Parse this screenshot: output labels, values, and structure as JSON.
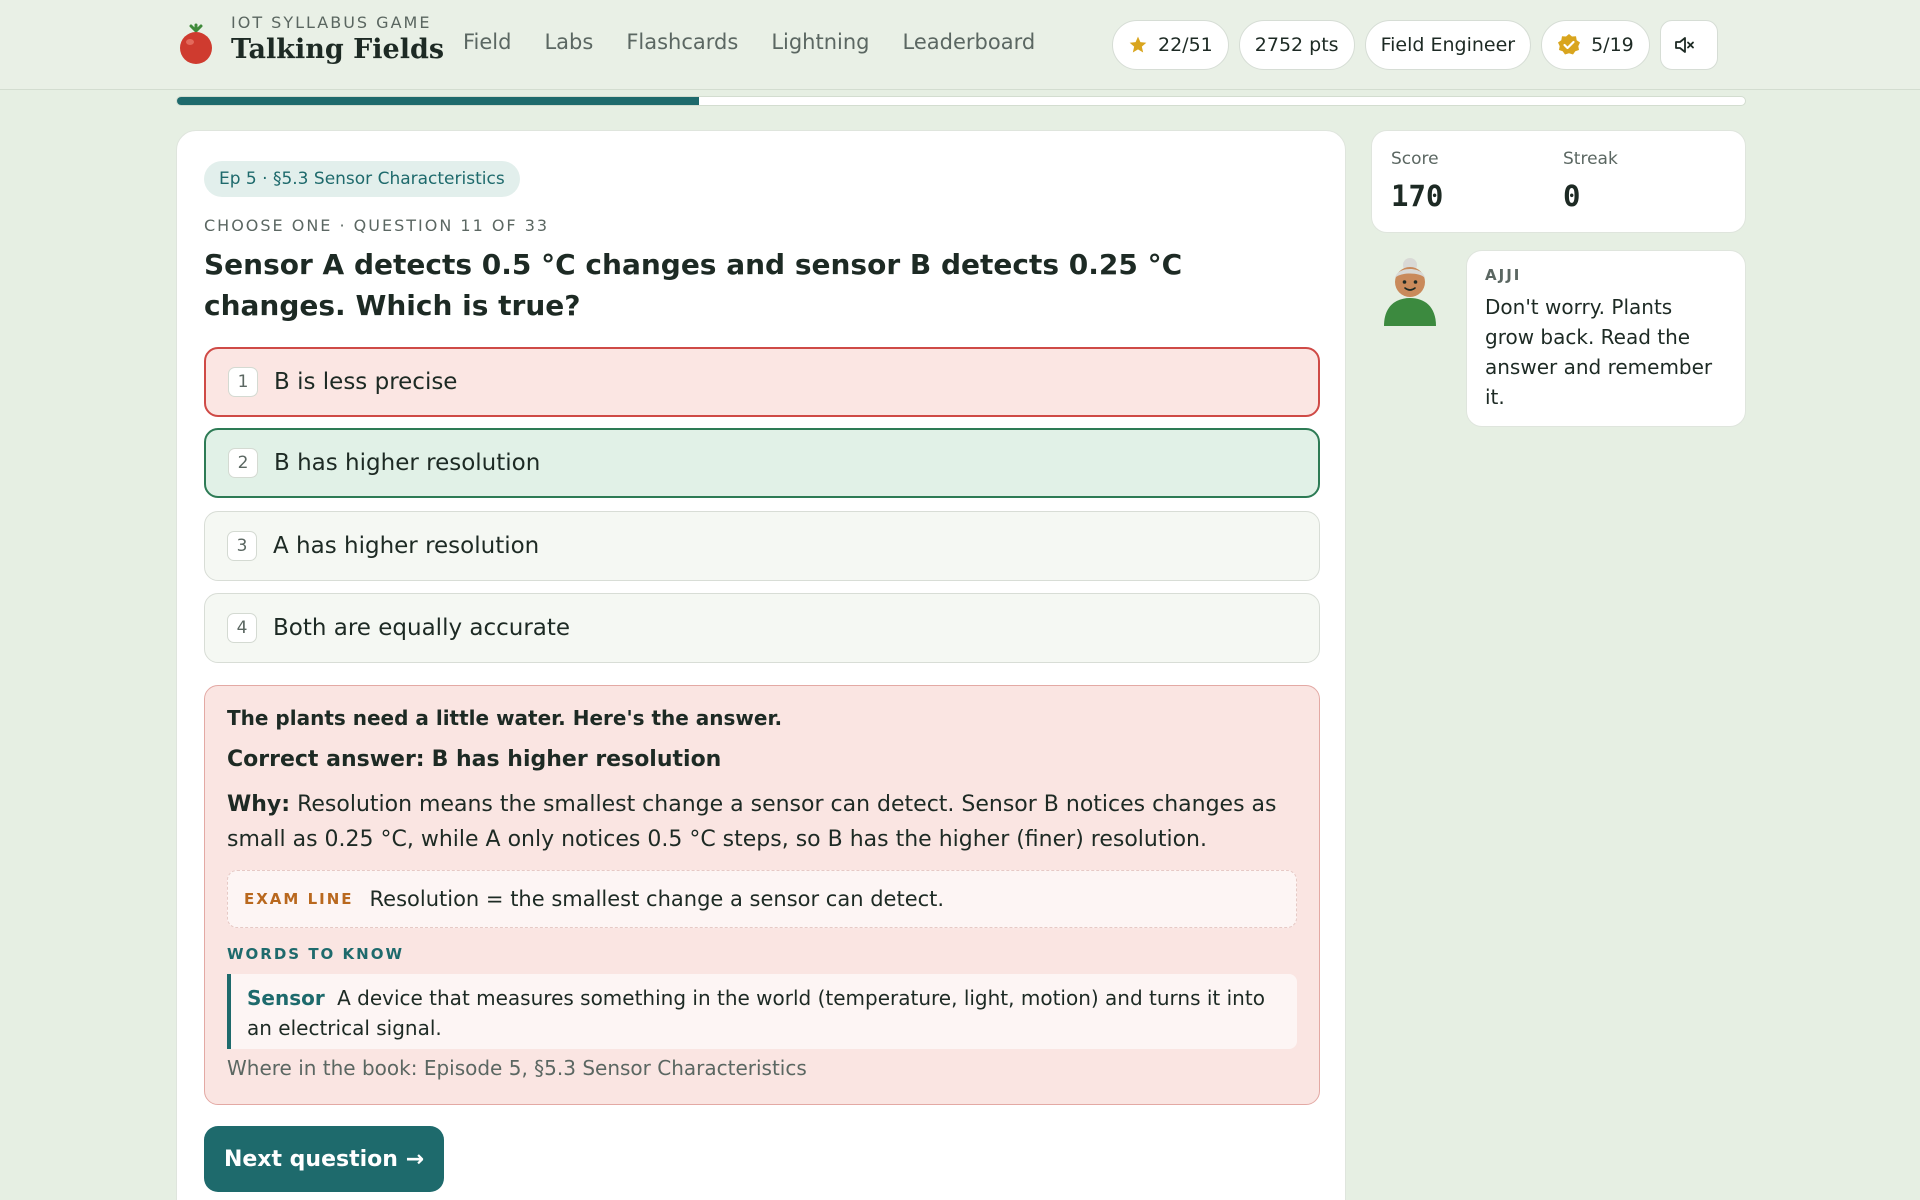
{
  "header": {
    "brand_sub": "IOT SYLLABUS GAME",
    "brand_title": "Talking Fields",
    "nav": [
      "Field",
      "Labs",
      "Flashcards",
      "Lightning",
      "Leaderboard"
    ],
    "stars": "22/51",
    "points": "2752 pts",
    "rank": "Field Engineer",
    "badges": "5/19",
    "sound_icon": "mute-icon"
  },
  "progress": {
    "fraction": 0.333
  },
  "quiz": {
    "chapter_badge": "Ep 5 · §5.3 Sensor Characteristics",
    "meta": "CHOOSE ONE · QUESTION 11 OF 33",
    "question": "Sensor A detects 0.5 °C changes and sensor B detects 0.25 °C changes. Which is true?",
    "options": [
      {
        "num": "1",
        "text": "B is less precise",
        "state": "wrong"
      },
      {
        "num": "2",
        "text": "B has higher resolution",
        "state": "correct"
      },
      {
        "num": "3",
        "text": "A has higher resolution",
        "state": "neutral"
      },
      {
        "num": "4",
        "text": "Both are equally accurate",
        "state": "neutral"
      }
    ]
  },
  "feedback": {
    "heading": "The plants need a little water. Here's the answer.",
    "correct_label": "Correct answer:",
    "correct_value": "B has higher resolution",
    "why_label": "Why:",
    "why_text": "Resolution means the smallest change a sensor can detect. Sensor B notices changes as small as 0.25 °C, while A only notices 0.5 °C steps, so B has the higher (finer) resolution.",
    "exam_label": "EXAM LINE",
    "exam_text": "Resolution = the smallest change a sensor can detect.",
    "words_label": "WORDS TO KNOW",
    "word_term": "Sensor",
    "word_def": "A device that measures something in the world (temperature, light, motion) and turns it into an electrical signal.",
    "book_ref": "Where in the book: Episode 5, §5.3 Sensor Characteristics"
  },
  "next_button": "Next question →",
  "stats": {
    "score_label": "Score",
    "score_value": "170",
    "streak_label": "Streak",
    "streak_value": "0"
  },
  "mentor": {
    "name": "AJJI",
    "message": "Don't worry. Plants grow back. Read the answer and remember it."
  },
  "colors": {
    "accent": "#1e6a6c",
    "wrong": "#cf4a46",
    "correct": "#2d7b55",
    "background": "#e6efe3"
  }
}
